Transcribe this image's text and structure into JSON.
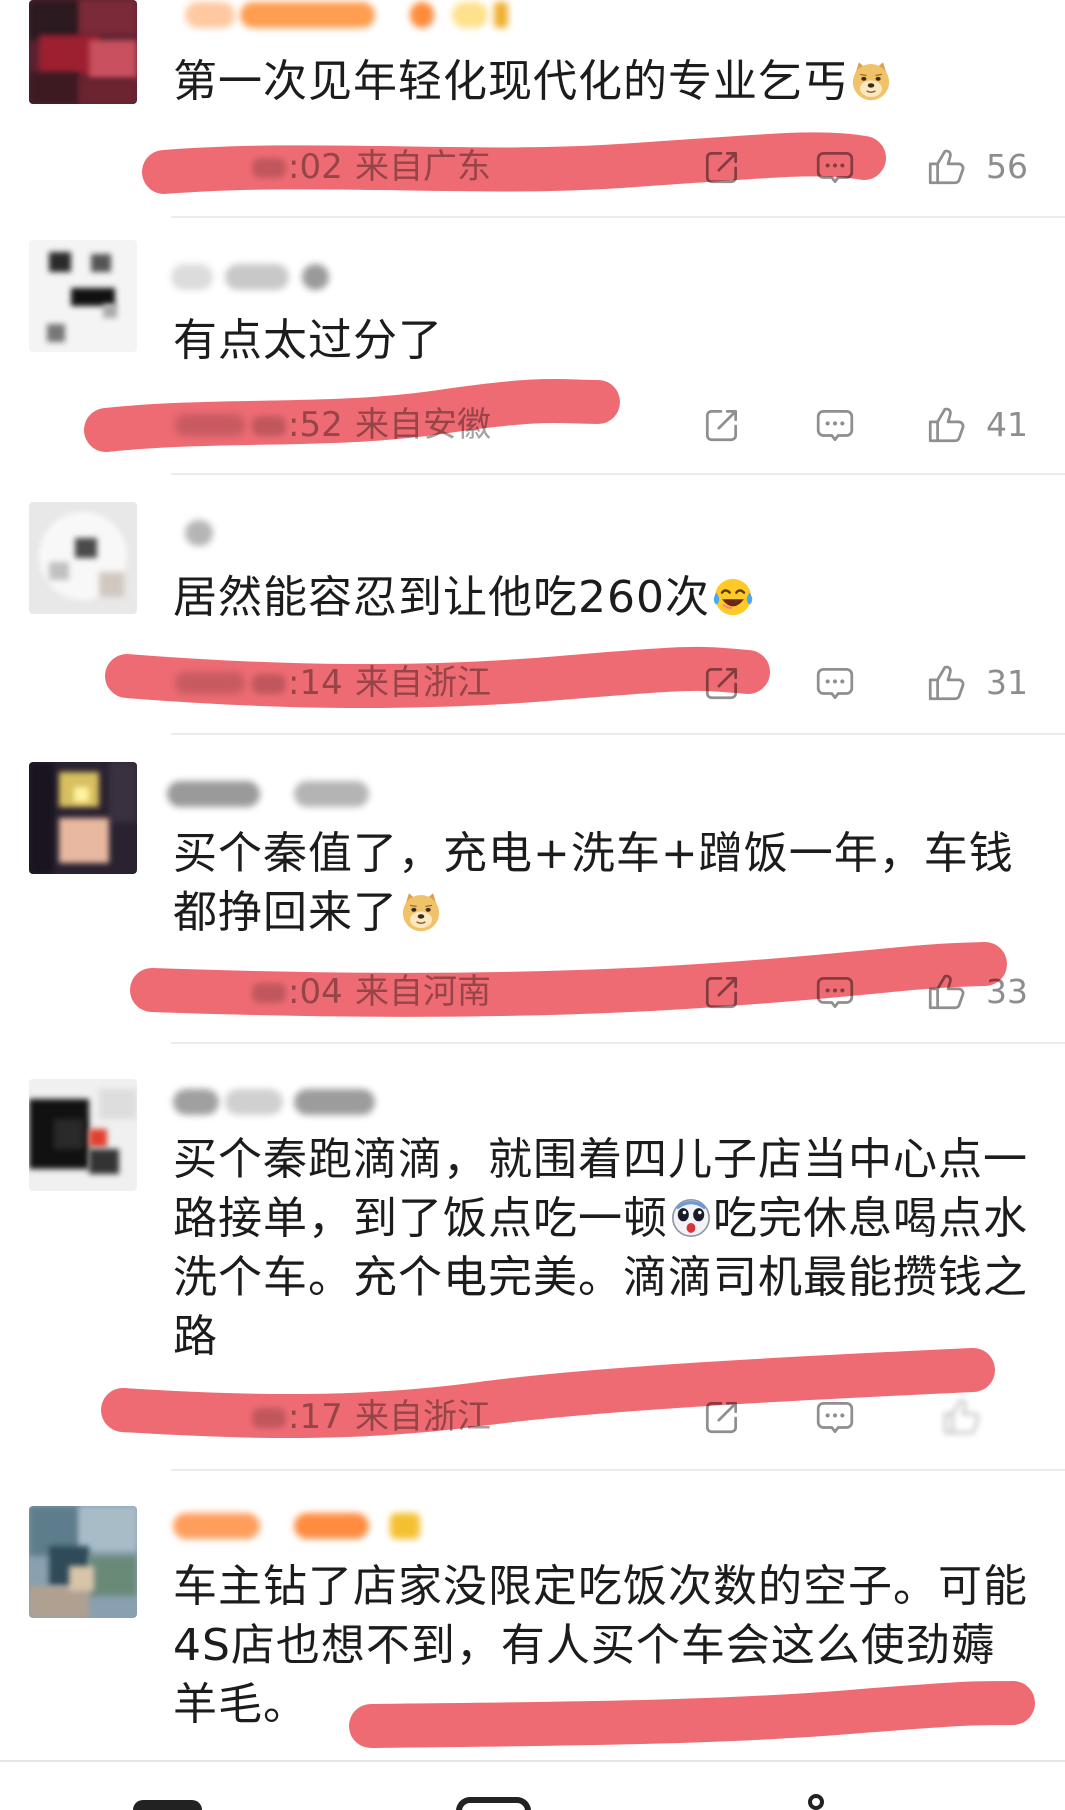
{
  "comments": [
    {
      "lines": [
        [
          "第一次见年轻化现代化的专业乞丐"
        ]
      ],
      "emojis": [
        "doge-emoji-icon"
      ],
      "time": ":02",
      "location": "来自广东",
      "likes": "56"
    },
    {
      "lines": [
        [
          "有点太过分了"
        ]
      ],
      "time": ":52",
      "location": "来自安徽",
      "likes": "41"
    },
    {
      "lines": [
        [
          "居然能容忍到让他吃260次"
        ]
      ],
      "emojis": [
        "laugh-cry-emoji-icon"
      ],
      "time": ":14",
      "location": "来自浙江",
      "likes": "31"
    },
    {
      "lines": [
        [
          "买个秦值了，充电+洗车+蹭饭一年，车钱"
        ],
        [
          "都挣回来了"
        ]
      ],
      "emojis": [
        "doge-emoji-icon"
      ],
      "time": ":04",
      "location": "来自河南",
      "likes": "33"
    },
    {
      "lines": [
        [
          "买个秦跑滴滴，就围着四儿子店当中心点一"
        ],
        [
          "路接单，到了饭点吃一顿",
          "吃完休息喝点水"
        ],
        [
          "洗个车。充个电完美。滴滴司机最能攒钱之"
        ],
        [
          "路"
        ]
      ],
      "emojis": [
        "scared-emoji-icon"
      ],
      "time": ":17",
      "location": "来自浙江"
    },
    {
      "lines": [
        [
          "车主钻了店家没限定吃饭次数的空子。可能"
        ],
        [
          "4S店也想不到，有人买个车会这么使劲薅"
        ],
        [
          "羊毛。"
        ]
      ]
    }
  ],
  "action_icons": {
    "share": "share-icon",
    "comment": "comment-icon",
    "like": "like-icon"
  },
  "colors": {
    "text": "#1c1c1c",
    "meta_text": "#a2a2a2",
    "icon": "#8f8f8f",
    "divider": "#ececec",
    "redaction_marker": "#ec5b64",
    "vip_username": "#ff8c40"
  }
}
